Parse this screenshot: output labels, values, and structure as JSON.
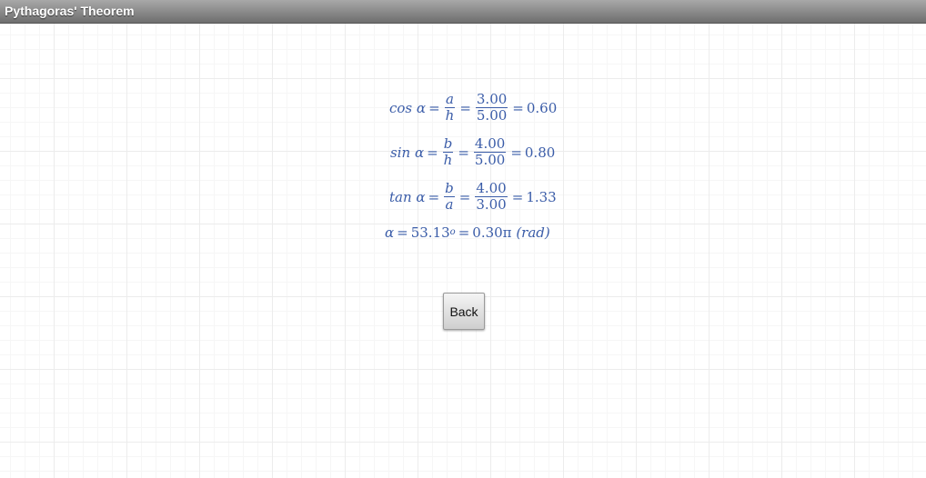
{
  "window": {
    "title": "Pythagoras' Theorem"
  },
  "results": {
    "cos": {
      "func": "cos",
      "angle": "α",
      "eq1": "=",
      "num_sym": "a",
      "den_sym": "h",
      "eq2": "=",
      "num_val": "3.00",
      "den_val": "5.00",
      "eq3": "=",
      "result": "0.60"
    },
    "sin": {
      "func": "sin",
      "angle": "α",
      "eq1": "=",
      "num_sym": "b",
      "den_sym": "h",
      "eq2": "=",
      "num_val": "4.00",
      "den_val": "5.00",
      "eq3": "=",
      "result": "0.80"
    },
    "tan": {
      "func": "tan",
      "angle": "α",
      "eq1": "=",
      "num_sym": "b",
      "den_sym": "a",
      "eq2": "=",
      "num_val": "4.00",
      "den_val": "3.00",
      "eq3": "=",
      "result": "1.33"
    },
    "angle": {
      "symbol": "α",
      "eq1": "=",
      "degrees": "53.13",
      "deg_unit": "o",
      "eq2": "=",
      "radians": "0.30π",
      "rad_unit": "(rad)"
    }
  },
  "buttons": {
    "back_label": "Back"
  }
}
